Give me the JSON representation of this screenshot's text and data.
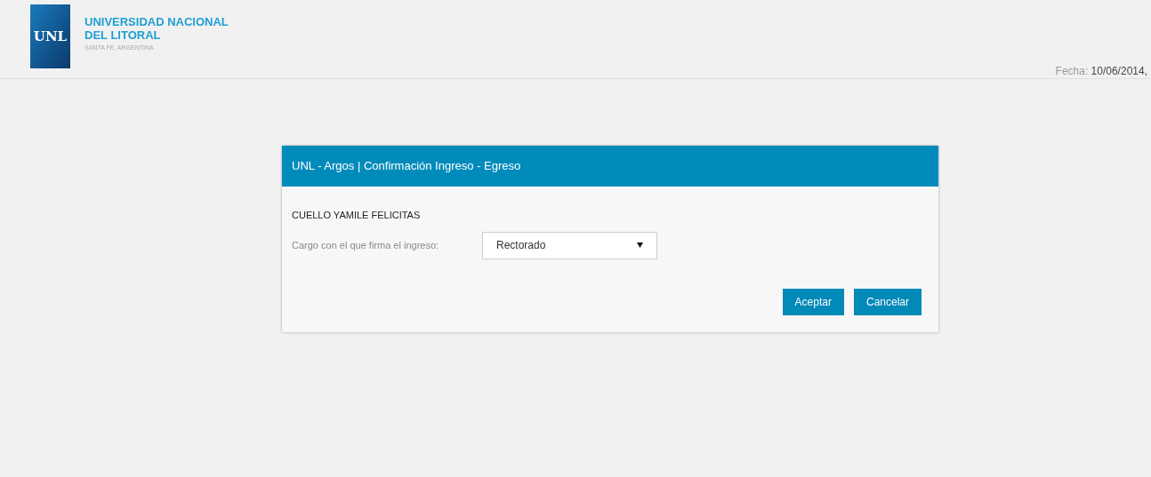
{
  "header": {
    "logo_text": "UNL",
    "name_line_1": "UNIVERSIDAD NACIONAL",
    "name_line_2": "DEL LITORAL",
    "location": "SANTA FE, ARGENTINA",
    "date_label": "Fecha:",
    "date_value": "10/06/2014,"
  },
  "dialog": {
    "title": "UNL - Argos | Confirmación Ingreso - Egreso",
    "person": "CUELLO YAMILE FELICITAS",
    "field_label": "Cargo con el que firma el ingreso:",
    "select_value": "Rectorado",
    "buttons": [
      "Aceptar",
      "Cancelar"
    ]
  }
}
